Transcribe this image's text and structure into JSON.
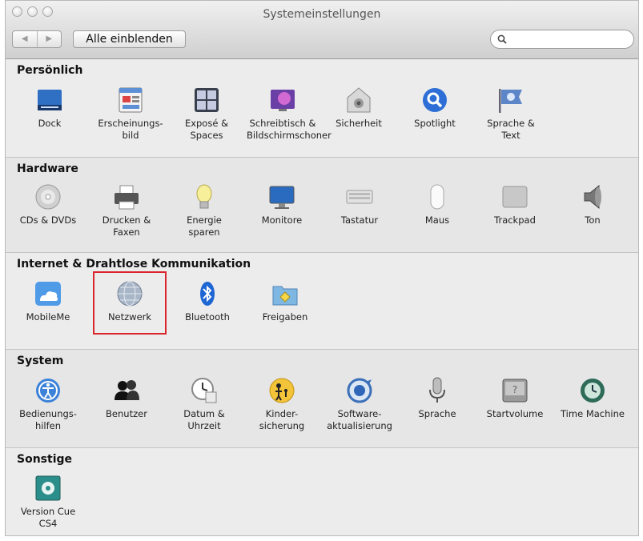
{
  "window": {
    "title": "Systemeinstellungen"
  },
  "toolbar": {
    "back_label": "◀",
    "forward_label": "▶",
    "show_all_label": "Alle einblenden",
    "search_placeholder": ""
  },
  "sections": {
    "personal": {
      "title": "Persönlich",
      "items": [
        {
          "label": "Dock",
          "icon": "dock-icon"
        },
        {
          "label": "Erscheinungs-\nbild",
          "icon": "appearance-icon"
        },
        {
          "label": "Exposé &\nSpaces",
          "icon": "expose-spaces-icon"
        },
        {
          "label": "Schreibtisch &\nBildschirmschoner",
          "icon": "desktop-screensaver-icon"
        },
        {
          "label": "Sicherheit",
          "icon": "security-icon"
        },
        {
          "label": "Spotlight",
          "icon": "spotlight-icon"
        },
        {
          "label": "Sprache &\nText",
          "icon": "language-text-icon"
        }
      ]
    },
    "hardware": {
      "title": "Hardware",
      "items": [
        {
          "label": "CDs & DVDs",
          "icon": "cd-dvd-icon"
        },
        {
          "label": "Drucken &\nFaxen",
          "icon": "printer-icon"
        },
        {
          "label": "Energie\nsparen",
          "icon": "energy-saver-icon"
        },
        {
          "label": "Monitore",
          "icon": "monitor-icon"
        },
        {
          "label": "Tastatur",
          "icon": "keyboard-icon"
        },
        {
          "label": "Maus",
          "icon": "mouse-icon"
        },
        {
          "label": "Trackpad",
          "icon": "trackpad-icon"
        },
        {
          "label": "Ton",
          "icon": "speaker-icon"
        }
      ]
    },
    "internet": {
      "title": "Internet & Drahtlose Kommunikation",
      "items": [
        {
          "label": "MobileMe",
          "icon": "mobileme-icon"
        },
        {
          "label": "Netzwerk",
          "icon": "network-icon"
        },
        {
          "label": "Bluetooth",
          "icon": "bluetooth-icon"
        },
        {
          "label": "Freigaben",
          "icon": "sharing-icon"
        }
      ]
    },
    "system": {
      "title": "System",
      "items": [
        {
          "label": "Bedienungs-\nhilfen",
          "icon": "accessibility-icon"
        },
        {
          "label": "Benutzer",
          "icon": "users-icon"
        },
        {
          "label": "Datum &\nUhrzeit",
          "icon": "date-time-icon"
        },
        {
          "label": "Kinder-\nsicherung",
          "icon": "parental-controls-icon"
        },
        {
          "label": "Software-\naktualisierung",
          "icon": "software-update-icon"
        },
        {
          "label": "Sprache",
          "icon": "speech-icon"
        },
        {
          "label": "Startvolume",
          "icon": "startup-disk-icon"
        },
        {
          "label": "Time Machine",
          "icon": "time-machine-icon"
        }
      ]
    },
    "other": {
      "title": "Sonstige",
      "items": [
        {
          "label": "Version Cue\nCS4",
          "icon": "version-cue-icon"
        }
      ]
    }
  },
  "highlight": {
    "target": "Netzwerk",
    "color": "#d9262d"
  }
}
